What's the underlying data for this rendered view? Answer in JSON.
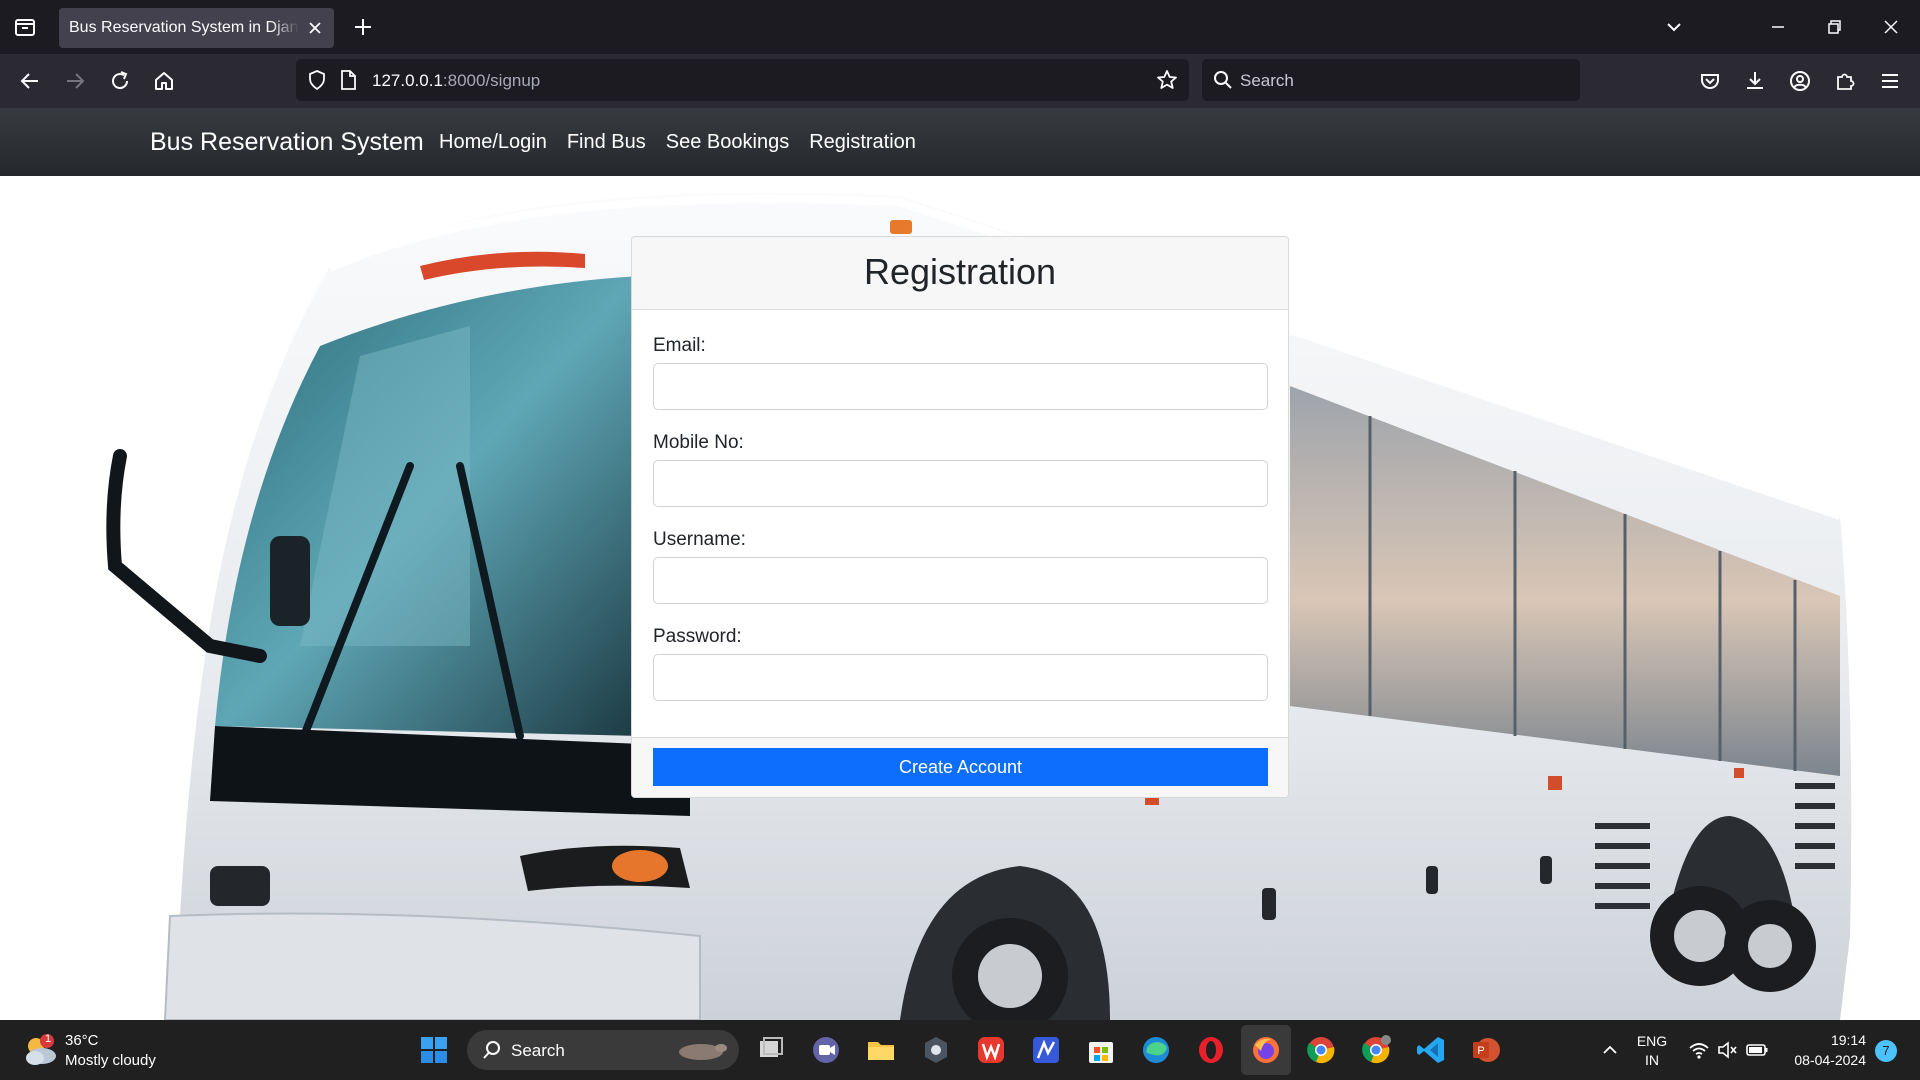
{
  "browser": {
    "tab_title": "Bus Reservation System in Django Framework",
    "url_host": "127.0.0.1",
    "url_path": ":8000/signup",
    "search_placeholder": "Search"
  },
  "site": {
    "brand": "Bus Reservation System",
    "nav_links": [
      "Home/Login",
      "Find Bus",
      "See Bookings",
      "Registration"
    ]
  },
  "form": {
    "title": "Registration",
    "fields": [
      {
        "label": "Email:",
        "value": ""
      },
      {
        "label": "Mobile No:",
        "value": ""
      },
      {
        "label": "Username:",
        "value": ""
      },
      {
        "label": "Password:",
        "value": ""
      }
    ],
    "submit_label": "Create Account"
  },
  "taskbar": {
    "weather_badge": "1",
    "temperature": "36°C",
    "weather": "Mostly cloudy",
    "search_label": "Search",
    "language": "ENG",
    "region": "IN",
    "time": "19:14",
    "date": "08-04-2024",
    "notification_count": "7"
  },
  "colors": {
    "primary_button": "#0d6efd",
    "navbar": "#2f3236",
    "browser_chrome": "#1c1b22"
  }
}
